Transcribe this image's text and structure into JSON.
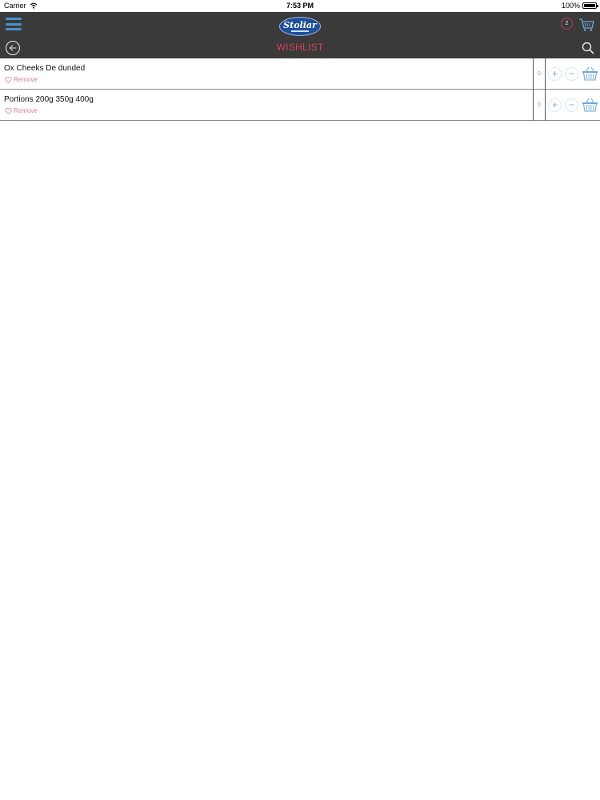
{
  "status_bar": {
    "carrier": "Carrier",
    "time": "7:53 PM",
    "battery": "100%"
  },
  "header": {
    "logo_text": "Stoliar",
    "wishlist_count": "2",
    "title": "WISHLIST"
  },
  "wishlist": {
    "items": [
      {
        "name": "Ox Cheeks De dunded",
        "remove_label": "Remove",
        "quantity": "0"
      },
      {
        "name": "Portions 200g 350g 400g",
        "remove_label": "Remove",
        "quantity": "0"
      }
    ]
  },
  "colors": {
    "header_bg": "#3a3a3a",
    "title_accent": "#d6405a",
    "remove_color": "#e07b8a",
    "icon_blue": "#6fa8de"
  },
  "icons": [
    "menu-icon",
    "cart-icon",
    "back-arrow-icon",
    "search-icon",
    "heart-icon",
    "plus-icon",
    "minus-icon",
    "basket-icon"
  ]
}
